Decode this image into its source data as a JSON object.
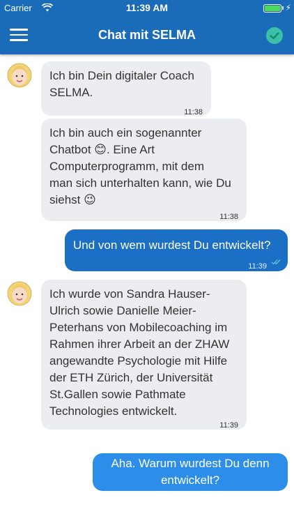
{
  "status_bar": {
    "carrier": "Carrier",
    "time": "11:39 AM"
  },
  "header": {
    "title": "Chat mit SELMA"
  },
  "messages": [
    {
      "sender": "coach",
      "text": "Ich bin Dein digitaler Coach\nSELMA.",
      "time": "11:38"
    },
    {
      "sender": "coach",
      "text": "Ich bin auch ein sogenannter\nChatbot 😊. Eine Art\nComputerprogramm, mit dem\nman sich unterhalten kann, wie Du\nsiehst 😉",
      "time": "11:38"
    },
    {
      "sender": "user",
      "text": "Und von wem wurdest Du entwickelt?",
      "time": "11:39",
      "read": true
    },
    {
      "sender": "coach",
      "text": "Ich wurde von Sandra Hauser-\nUlrich sowie Danielle Meier-\nPeterhans von Mobilecoaching im\nRahmen ihrer Arbeit an der ZHAW\nangewandte Psychologie mit Hilfe\nder ETH Zürich, der Universität\nSt.Gallen sowie Pathmate\nTechnologies entwickelt.",
      "time": "11:39"
    },
    {
      "sender": "user",
      "text": "Aha. Warum wurdest Du denn\nentwickelt?"
    }
  ],
  "icons": {
    "menu": "hamburger-icon",
    "confirm": "check-circle-icon",
    "avatar": "selma-avatar",
    "read_receipt": "double-check-icon"
  },
  "colors": {
    "header": "#1a6bb8",
    "user_bubble": "#1b6fc4",
    "coach_bubble": "#ebedf0",
    "confirm": "#3cc0a8"
  }
}
